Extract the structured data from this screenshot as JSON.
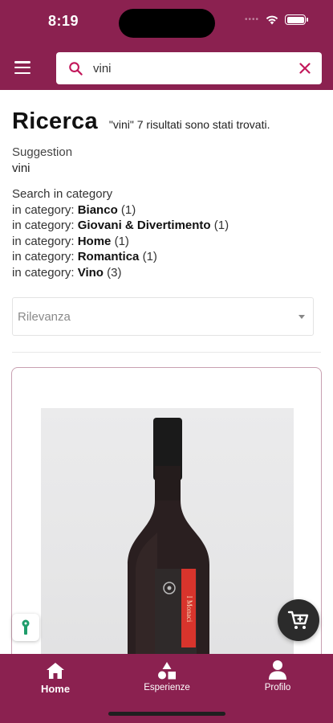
{
  "status_bar": {
    "time": "8:19"
  },
  "search": {
    "value": "vini",
    "placeholder": ""
  },
  "header": {
    "title": "Ricerca",
    "results_text": "\"vini\" 7 risultati sono stati trovati."
  },
  "suggestion": {
    "label": "Suggestion",
    "value": "vini"
  },
  "categories": {
    "heading": "Search in category",
    "prefix": "in category:",
    "items": [
      {
        "name": "Bianco",
        "count": "(1)"
      },
      {
        "name": "Giovani & Divertimento",
        "count": "(1)"
      },
      {
        "name": "Home",
        "count": "(1)"
      },
      {
        "name": "Romantica",
        "count": "(1)"
      },
      {
        "name": "Vino",
        "count": "(3)"
      }
    ]
  },
  "sort": {
    "selected": "Rilevanza"
  },
  "product": {
    "label_text": "I Monaci"
  },
  "bottom_nav": [
    {
      "label": "Home",
      "icon": "home-icon",
      "active": true
    },
    {
      "label": "Esperienze",
      "icon": "shapes-icon",
      "active": false
    },
    {
      "label": "Profilo",
      "icon": "person-icon",
      "active": false
    }
  ],
  "colors": {
    "brand": "#8b2150",
    "fab": "#2b2b2b",
    "key_badge": "#1f9d6b"
  }
}
